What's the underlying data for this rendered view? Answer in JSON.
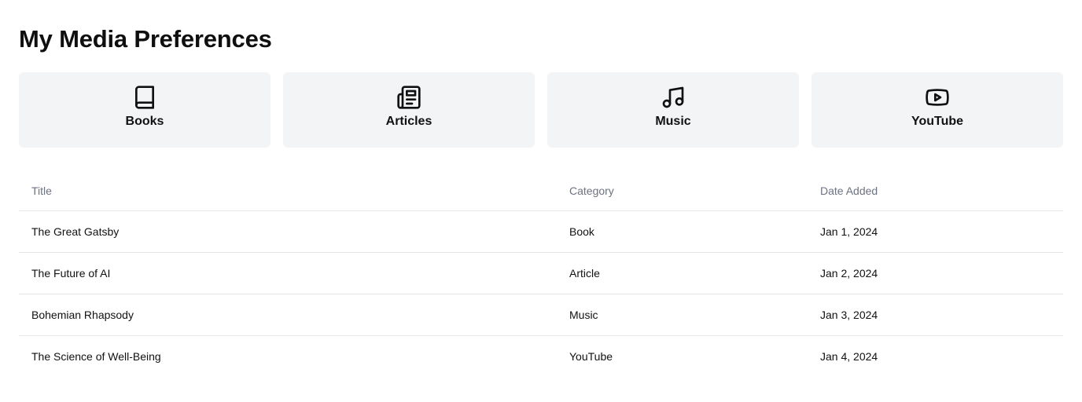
{
  "header": {
    "title": "My Media Preferences"
  },
  "categories": [
    {
      "label": "Books",
      "icon": "book-icon"
    },
    {
      "label": "Articles",
      "icon": "newspaper-icon"
    },
    {
      "label": "Music",
      "icon": "music-note-icon"
    },
    {
      "label": "YouTube",
      "icon": "youtube-icon"
    }
  ],
  "table": {
    "columns": [
      "Title",
      "Category",
      "Date Added"
    ],
    "rows": [
      {
        "title": "The Great Gatsby",
        "category": "Book",
        "date": "Jan 1, 2024"
      },
      {
        "title": "The Future of AI",
        "category": "Article",
        "date": "Jan 2, 2024"
      },
      {
        "title": "Bohemian Rhapsody",
        "category": "Music",
        "date": "Jan 3, 2024"
      },
      {
        "title": "The Science of Well-Being",
        "category": "YouTube",
        "date": "Jan 4, 2024"
      }
    ]
  },
  "colors": {
    "card_background": "#f3f4f6",
    "header_text": "#6b7280",
    "divider": "#e5e7eb",
    "text": "#111111"
  }
}
